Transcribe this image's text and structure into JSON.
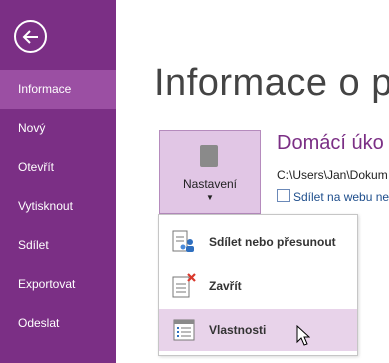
{
  "sidebar": {
    "items": [
      {
        "label": "Informace",
        "active": true
      },
      {
        "label": "Nový"
      },
      {
        "label": "Otevřít"
      },
      {
        "label": "Vytisknout"
      },
      {
        "label": "Sdílet"
      },
      {
        "label": "Exportovat"
      },
      {
        "label": "Odeslat"
      }
    ]
  },
  "main": {
    "title": "Informace o p",
    "settings_label": "Nastavení",
    "notebook_title": "Domácí úko",
    "notebook_path": "C:\\Users\\Jan\\Dokum",
    "share_link": "Sdílet na webu ne"
  },
  "menu": {
    "items": [
      {
        "label": "Sdílet nebo přesunout"
      },
      {
        "label": "Zavřít"
      },
      {
        "label": "Vlastnosti",
        "hovered": true
      }
    ]
  },
  "colors": {
    "accent": "#7b2f85",
    "active_nav": "#9b4fa3",
    "button_bg": "#e1c6e5",
    "menu_hover": "#e8d3ea"
  }
}
